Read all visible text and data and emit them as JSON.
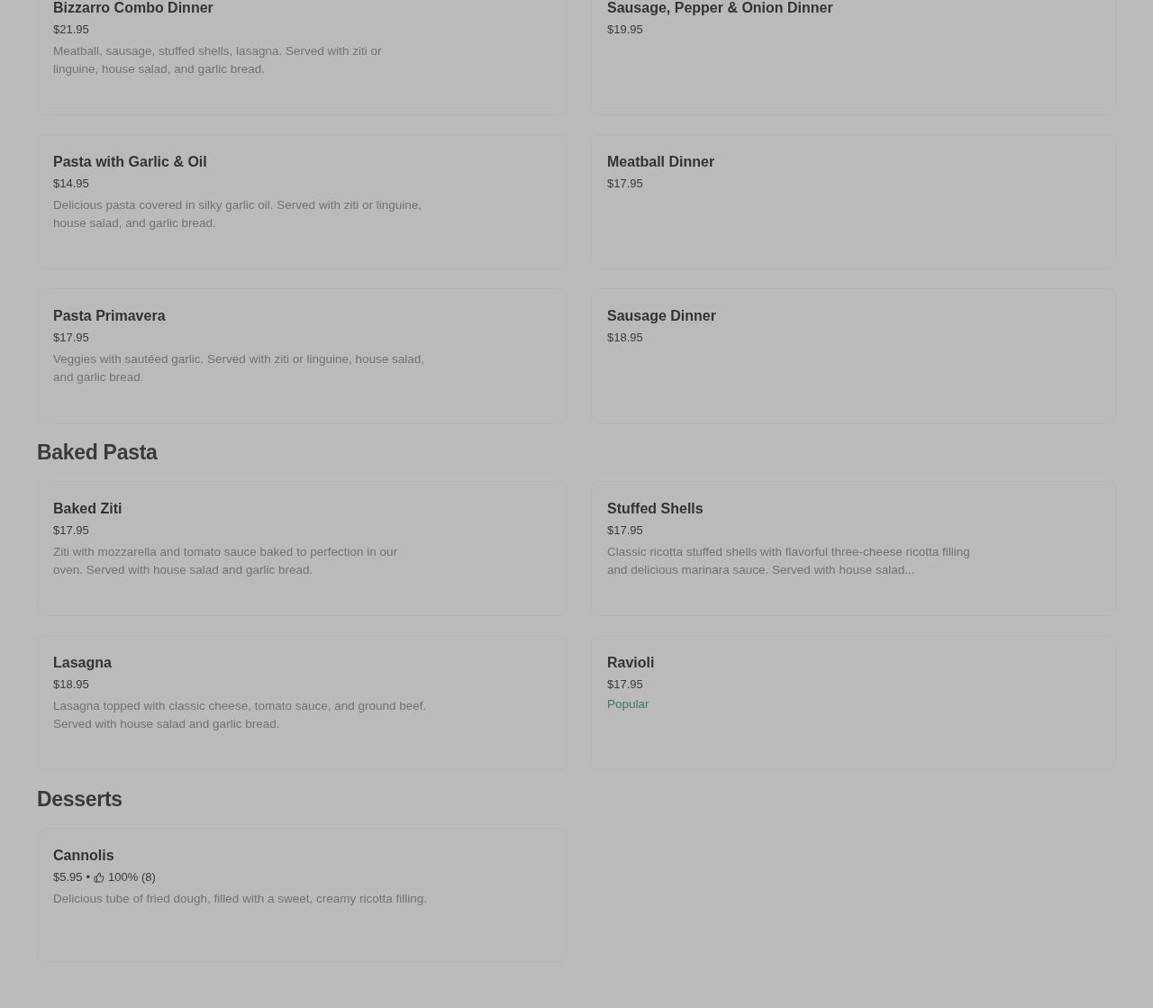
{
  "sections": [
    {
      "items": [
        {
          "name": "Bizzarro Combo Dinner",
          "price": "$21.95",
          "description": "Meatball, sausage, stuffed shells, lasagna. Served with ziti or linguine, house salad, and garlic bread."
        },
        {
          "name": "Sausage, Pepper & Onion Dinner",
          "price": "$19.95"
        },
        {
          "name": "Pasta with Garlic & Oil",
          "price": "$14.95",
          "description": "Delicious pasta covered in silky garlic oil. Served with ziti or linguine, house salad, and garlic bread."
        },
        {
          "name": "Meatball Dinner",
          "price": "$17.95"
        },
        {
          "name": "Pasta Primavera",
          "price": "$17.95",
          "description": "Veggies with sautéed garlic. Served with ziti or linguine, house salad, and garlic bread."
        },
        {
          "name": "Sausage Dinner",
          "price": "$18.95"
        }
      ]
    },
    {
      "heading": "Baked Pasta",
      "items": [
        {
          "name": "Baked Ziti",
          "price": "$17.95",
          "description": "Ziti with mozzarella and tomato sauce baked to perfection in our oven. Served with house salad and garlic bread."
        },
        {
          "name": "Stuffed Shells",
          "price": "$17.95",
          "description": "Classic ricotta stuffed shells with flavorful three-cheese ricotta filling and delicious marinara sauce. Served with house salad..."
        },
        {
          "name": "Lasagna",
          "price": "$18.95",
          "description": "Lasagna topped with classic cheese, tomato sauce, and ground beef. Served with house salad and garlic bread."
        },
        {
          "name": "Ravioli",
          "price": "$17.95",
          "tag": "Popular"
        }
      ]
    },
    {
      "heading": "Desserts",
      "items": [
        {
          "name": "Cannolis",
          "price": "$5.95",
          "separator": "•",
          "rating": "100% (8)",
          "description": "Delicious tube of fried dough, filled with a sweet, creamy ricotta filling."
        }
      ]
    }
  ]
}
